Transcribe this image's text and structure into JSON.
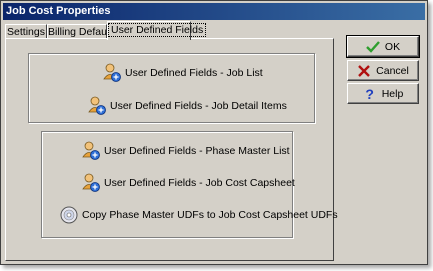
{
  "window": {
    "title": "Job Cost Properties"
  },
  "tabs": [
    {
      "label": "Settings"
    },
    {
      "label": "Billing Defaults"
    },
    {
      "label": "User Defined Fields"
    }
  ],
  "links": {
    "job_list": "User Defined Fields - Job List",
    "job_detail_items": "User Defined Fields - Job Detail Items",
    "phase_master_list": "User Defined Fields - Phase Master List",
    "job_cost_capsheet": "User Defined Fields - Job Cost Capsheet",
    "copy_udfs": "Copy Phase Master UDFs to Job Cost Capsheet UDFs"
  },
  "buttons": {
    "ok": "OK",
    "cancel": "Cancel",
    "help": "Help"
  },
  "colors": {
    "titlebar_start": "#0a246a",
    "titlebar_end": "#3a6ea5",
    "dialog_bg": "#d4d0c8",
    "ok_check": "#2e9e2e",
    "cancel_x": "#b01010",
    "help_q": "#1f3fbf"
  }
}
